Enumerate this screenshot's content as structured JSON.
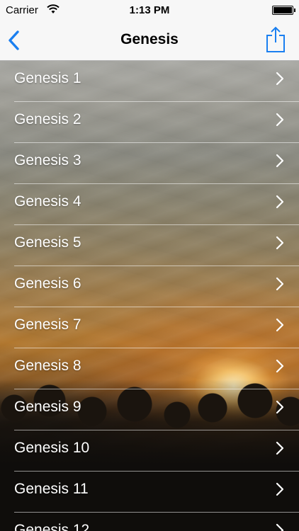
{
  "status_bar": {
    "carrier": "Carrier",
    "time": "1:13 PM"
  },
  "nav": {
    "title": "Genesis",
    "back_icon": "chevron-left-icon",
    "share_icon": "share-icon"
  },
  "colors": {
    "accent": "#1a7ff0",
    "row_text": "#ffffff"
  },
  "chapters": [
    {
      "label": "Genesis 1"
    },
    {
      "label": "Genesis 2"
    },
    {
      "label": "Genesis 3"
    },
    {
      "label": "Genesis 4"
    },
    {
      "label": "Genesis 5"
    },
    {
      "label": "Genesis 6"
    },
    {
      "label": "Genesis 7"
    },
    {
      "label": "Genesis 8"
    },
    {
      "label": "Genesis 9"
    },
    {
      "label": "Genesis 10"
    },
    {
      "label": "Genesis 11"
    },
    {
      "label": "Genesis 12"
    }
  ]
}
